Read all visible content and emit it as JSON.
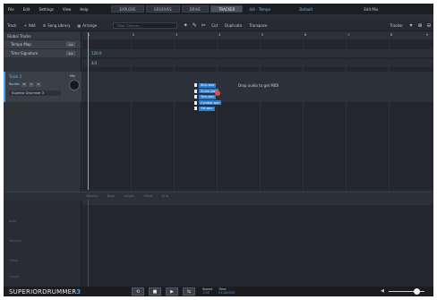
{
  "menubar": {
    "items": [
      "File",
      "Edit",
      "Settings",
      "View",
      "Help"
    ],
    "tabs": [
      "EXPLORE",
      "GROOVES",
      "DRIVE",
      "TRACKER"
    ],
    "active_tab": "TRACKER",
    "project": "4/4 - Tempo",
    "preset": "Default",
    "edit": "Edit Mix"
  },
  "toolbar": {
    "track_label": "Track",
    "add_label": "Add",
    "song_library_label": "Song Library",
    "arrange_label": "Arrange",
    "search_placeholder": "Filter Grooves",
    "cut_label": "Cut",
    "duplicate_label": "Duplicate",
    "transpose_label": "Transpose",
    "tracker_label": "Tracker"
  },
  "left_panel": {
    "header": "Global Tracks",
    "rows": [
      {
        "label": "Tempo Map",
        "chip": "4/4"
      },
      {
        "label": "Time Signature",
        "chip": "4/4"
      }
    ],
    "track": {
      "name": "Track 1",
      "mix_label": "Mix",
      "ctrl_label": "Routes",
      "ctrl_buttons": [
        "M",
        "S",
        "R"
      ],
      "instrument": "Superior Drummer 3"
    }
  },
  "timeline": {
    "ruler": [
      "1",
      "2",
      "3",
      "4",
      "5",
      "6",
      "7",
      "8",
      "9"
    ],
    "tempo_value": "120.0",
    "signature_value": "4/4",
    "drop_hint": "Drop audio to get MIDI",
    "drop_files": [
      "Kick.wav",
      "Snare.wav",
      "Tom.wav",
      "Cymbal.wav",
      "OH.wav"
    ]
  },
  "editor": {
    "header": [
      "Velocity",
      "Note",
      "Length",
      "Offset",
      "Grid"
    ],
    "labels": [
      "Note",
      "Velocity",
      "Offset",
      "Length"
    ]
  },
  "transport": {
    "logo_a": "SUPERIOR",
    "logo_b": "DRUMMER",
    "logo_version": "3",
    "buttons": [
      "⟲",
      "■",
      "▶",
      "⇆"
    ],
    "speed_label": "Speed",
    "speed_value": "1.00",
    "time_label": "Time",
    "time_value": "01:00:000",
    "volume_icon": "speaker-icon",
    "volume_level": 0.8
  }
}
